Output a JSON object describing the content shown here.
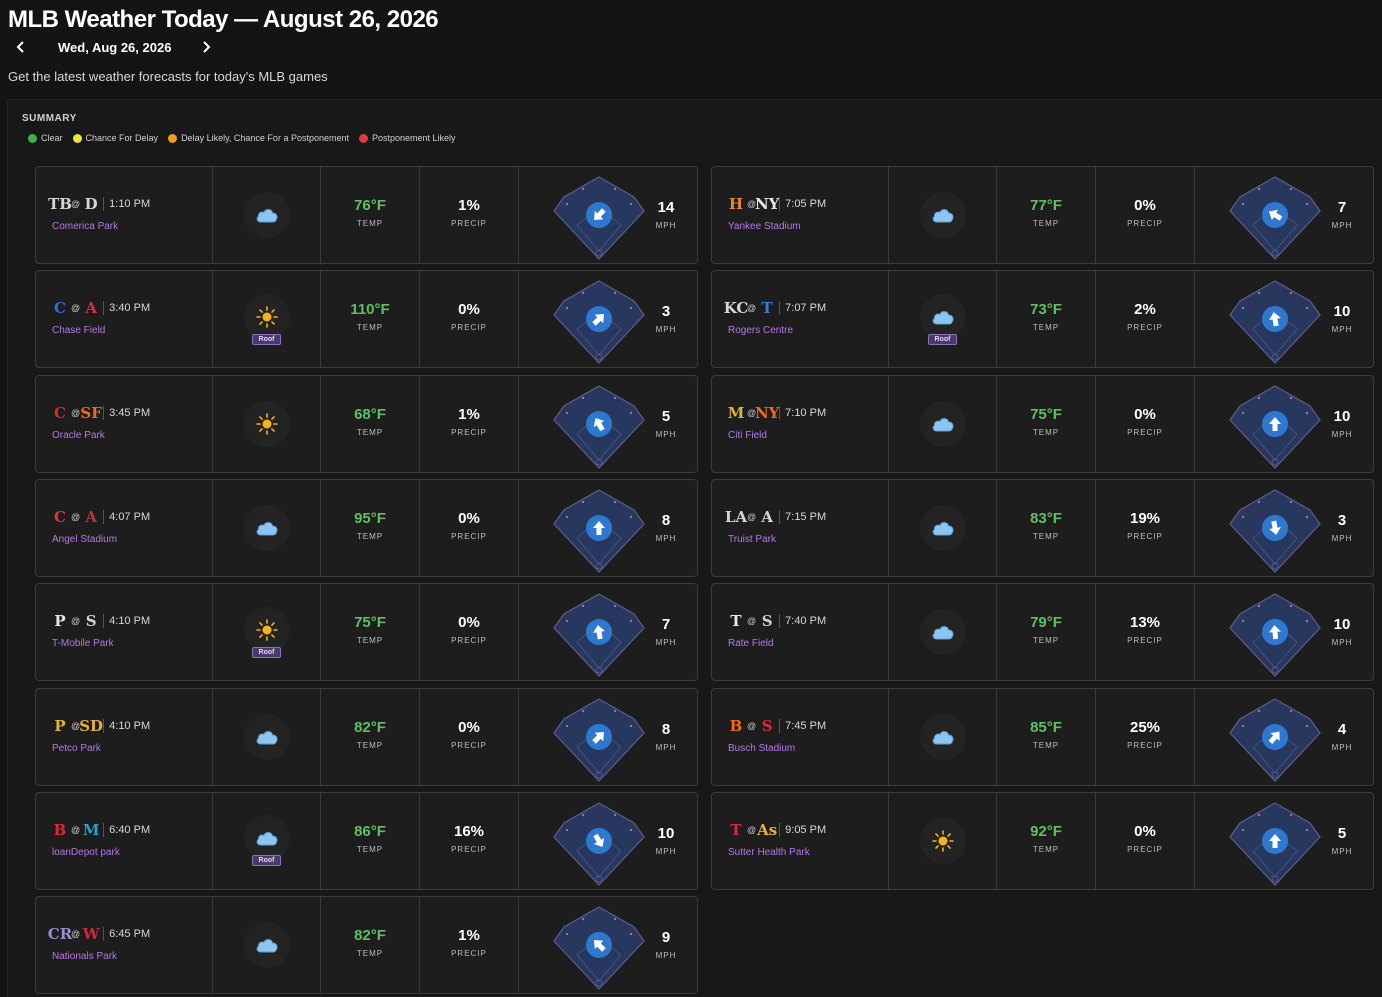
{
  "header": {
    "title": "MLB Weather Today — August 26, 2026",
    "date_label": "Wed, Aug 26, 2026",
    "prev_icon": "chevron-left-icon",
    "next_icon": "chevron-right-icon",
    "subtitle": "Get the latest weather forecasts for today's MLB games"
  },
  "summary": {
    "title": "SUMMARY",
    "legend": [
      {
        "label": "Clear",
        "color": "#3fb04a"
      },
      {
        "label": "Chance For Delay",
        "color": "#f2e33a"
      },
      {
        "label": "Delay Likely, Chance For a Postponement",
        "color": "#f29a23"
      },
      {
        "label": "Postponement Likely",
        "color": "#e23a3a"
      }
    ]
  },
  "labels": {
    "at": "@",
    "temp": "TEMP",
    "precip": "PRECIP",
    "mph": "MPH",
    "roof": "Roof"
  },
  "colors": {
    "temp_green": "#5fbf63",
    "venue_purple": "#b678e6",
    "wind_blue": "#2f78d0",
    "field_fill": "#2a3a66"
  },
  "games": [
    {
      "away": {
        "logo": "TB",
        "color": "#d6d6d6"
      },
      "home": {
        "logo": "D",
        "color": "#d6d6d6"
      },
      "time": "1:10 PM",
      "venue": "Comerica Park",
      "weather_icon": "cloud-icon",
      "roof": false,
      "temp": "76°F",
      "precip": "1%",
      "wind_mph": "14",
      "wind_dir_deg": 225
    },
    {
      "away": {
        "logo": "C",
        "color": "#2f6ed6"
      },
      "home": {
        "logo": "A",
        "color": "#c8354a"
      },
      "time": "3:40 PM",
      "venue": "Chase Field",
      "weather_icon": "sun-icon",
      "roof": true,
      "temp": "110°F",
      "precip": "0%",
      "wind_mph": "3",
      "wind_dir_deg": 45
    },
    {
      "away": {
        "logo": "C",
        "color": "#e0262d"
      },
      "home": {
        "logo": "SF",
        "color": "#f26a1b"
      },
      "time": "3:45 PM",
      "venue": "Oracle Park",
      "weather_icon": "sun-icon",
      "roof": false,
      "temp": "68°F",
      "precip": "1%",
      "wind_mph": "5",
      "wind_dir_deg": 330
    },
    {
      "away": {
        "logo": "C",
        "color": "#e3323a"
      },
      "home": {
        "logo": "A",
        "color": "#c0313f"
      },
      "time": "4:07 PM",
      "venue": "Angel Stadium",
      "weather_icon": "cloud-icon",
      "roof": false,
      "temp": "95°F",
      "precip": "0%",
      "wind_mph": "8",
      "wind_dir_deg": 0
    },
    {
      "away": {
        "logo": "P",
        "color": "#e8e8e8"
      },
      "home": {
        "logo": "S",
        "color": "#d0d0d0"
      },
      "time": "4:10 PM",
      "venue": "T-Mobile Park",
      "weather_icon": "sun-icon",
      "roof": true,
      "temp": "75°F",
      "precip": "0%",
      "wind_mph": "7",
      "wind_dir_deg": 350
    },
    {
      "away": {
        "logo": "P",
        "color": "#e0b43a"
      },
      "home": {
        "logo": "SD",
        "color": "#e0b43a"
      },
      "time": "4:10 PM",
      "venue": "Petco Park",
      "weather_icon": "cloud-icon",
      "roof": false,
      "temp": "82°F",
      "precip": "0%",
      "wind_mph": "8",
      "wind_dir_deg": 45
    },
    {
      "away": {
        "logo": "B",
        "color": "#d8283a"
      },
      "home": {
        "logo": "M",
        "color": "#2aa0c8"
      },
      "time": "6:40 PM",
      "venue": "loanDepot park",
      "weather_icon": "cloud-icon",
      "roof": true,
      "temp": "86°F",
      "precip": "16%",
      "wind_mph": "10",
      "wind_dir_deg": 150
    },
    {
      "away": {
        "logo": "CR",
        "color": "#a08ad0"
      },
      "home": {
        "logo": "W",
        "color": "#d0283a"
      },
      "time": "6:45 PM",
      "venue": "Nationals Park",
      "weather_icon": "cloud-icon",
      "roof": false,
      "temp": "82°F",
      "precip": "1%",
      "wind_mph": "9",
      "wind_dir_deg": 315
    },
    {
      "away": {
        "logo": "H",
        "color": "#e88a2a"
      },
      "home": {
        "logo": "NY",
        "color": "#e8e8e8"
      },
      "time": "7:05 PM",
      "venue": "Yankee Stadium",
      "weather_icon": "cloud-icon",
      "roof": false,
      "temp": "77°F",
      "precip": "0%",
      "wind_mph": "7",
      "wind_dir_deg": 300
    },
    {
      "away": {
        "logo": "KC",
        "color": "#d8d8d8"
      },
      "home": {
        "logo": "T",
        "color": "#3a7ad8"
      },
      "time": "7:07 PM",
      "venue": "Rogers Centre",
      "weather_icon": "cloud-icon",
      "roof": true,
      "temp": "73°F",
      "precip": "2%",
      "wind_mph": "10",
      "wind_dir_deg": 350
    },
    {
      "away": {
        "logo": "M",
        "color": "#e0b43a"
      },
      "home": {
        "logo": "NY",
        "color": "#f26a1b"
      },
      "time": "7:10 PM",
      "venue": "Citi Field",
      "weather_icon": "cloud-icon",
      "roof": false,
      "temp": "75°F",
      "precip": "0%",
      "wind_mph": "10",
      "wind_dir_deg": 0
    },
    {
      "away": {
        "logo": "LA",
        "color": "#d8d8d8"
      },
      "home": {
        "logo": "A",
        "color": "#d8d8d8"
      },
      "time": "7:15 PM",
      "venue": "Truist Park",
      "weather_icon": "cloud-icon",
      "roof": false,
      "temp": "83°F",
      "precip": "19%",
      "wind_mph": "3",
      "wind_dir_deg": 170
    },
    {
      "away": {
        "logo": "T",
        "color": "#e8e8e8"
      },
      "home": {
        "logo": "S",
        "color": "#d0d0d0"
      },
      "time": "7:40 PM",
      "venue": "Rate Field",
      "weather_icon": "cloud-icon",
      "roof": false,
      "temp": "79°F",
      "precip": "13%",
      "wind_mph": "10",
      "wind_dir_deg": 355
    },
    {
      "away": {
        "logo": "B",
        "color": "#f26a1b"
      },
      "home": {
        "logo": "S",
        "color": "#d8283a"
      },
      "time": "7:45 PM",
      "venue": "Busch Stadium",
      "weather_icon": "cloud-icon",
      "roof": false,
      "temp": "85°F",
      "precip": "25%",
      "wind_mph": "4",
      "wind_dir_deg": 40
    },
    {
      "away": {
        "logo": "T",
        "color": "#d8283a"
      },
      "home": {
        "logo": "As",
        "color": "#e0b43a"
      },
      "time": "9:05 PM",
      "venue": "Sutter Health Park",
      "weather_icon": "sun-icon",
      "roof": false,
      "temp": "92°F",
      "precip": "0%",
      "wind_mph": "5",
      "wind_dir_deg": 0
    }
  ]
}
